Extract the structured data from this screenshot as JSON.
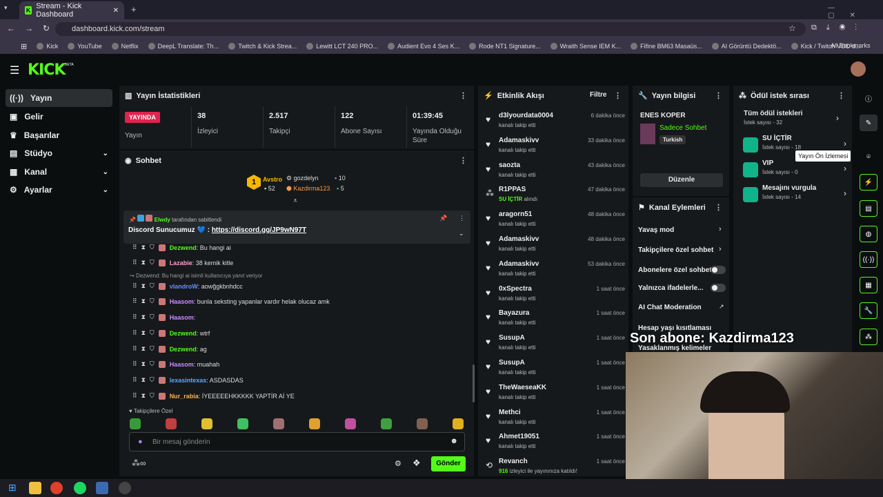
{
  "browser": {
    "tab_title": "Stream - Kick Dashboard",
    "url": "dashboard.kick.com/stream",
    "bookmarks": [
      "Kick",
      "YouTube",
      "Netflix",
      "DeepL Translate: Th...",
      "Twitch & Kick Strea...",
      "Lewitt LCT 240 PRO...",
      "Audient Evo 4 Ses K...",
      "Rode NT1 Signature...",
      "Wraith Sense IEM K...",
      "Fifine BM63 Masaüs...",
      "AI Görüntü Dedektö...",
      "Kick / Twitch VOD d..."
    ],
    "all_bookmarks": "All Bookmarks"
  },
  "logo": "KICK",
  "beta": "BETA",
  "sidebar": [
    {
      "label": "Yayın"
    },
    {
      "label": "Gelir"
    },
    {
      "label": "Başarılar"
    },
    {
      "label": "Stüdyo"
    },
    {
      "label": "Kanal"
    },
    {
      "label": "Ayarlar"
    }
  ],
  "stats": {
    "title": "Yayın İstatistikleri",
    "live_badge": "YAYINDA",
    "live_label": "Yayın",
    "items": [
      {
        "value": "38",
        "label": "İzleyici"
      },
      {
        "value": "2.517",
        "label": "Takipçi"
      },
      {
        "value": "122",
        "label": "Abone Sayısı"
      },
      {
        "value": "01:39:45",
        "label": "Yayında Olduğu Süre"
      }
    ]
  },
  "chat": {
    "title": "Sohbet",
    "leaders": [
      {
        "name": "Avstro",
        "count": "52"
      },
      {
        "name": "gozdelyn",
        "count": "10"
      },
      {
        "name": "Kazdirma123",
        "count": "5"
      }
    ],
    "pinned_by": "Elwdy",
    "pinned_suffix": "tarafından sabitlendi",
    "pinned_msg": "Discord Sunucumuz",
    "pinned_link": "https://discord.gg/JP9wN97T",
    "reply_note": "Dezwend: Bu hangi ai isimli kullanıcıya yanıt veriyor",
    "messages": [
      {
        "user": "Dezwend",
        "text": ": Bu hangi ai",
        "color": "#53fc18"
      },
      {
        "user": "Lazabie",
        "text": ": 38 kemik kitle",
        "color": "#ff9ecf"
      },
      {
        "user": "vlandroW",
        "text": ": aowğgkbnhdcc",
        "color": "#6a8cff"
      },
      {
        "user": "Haasom",
        "text": ": bunla seksting yapanlar vardır helak olucaz amk",
        "color": "#c88bff"
      },
      {
        "user": "Haasom",
        "text": ":",
        "color": "#c88bff"
      },
      {
        "user": "Dezwend",
        "text": ": wtrf",
        "color": "#53fc18"
      },
      {
        "user": "Dezwend",
        "text": ": ag",
        "color": "#53fc18"
      },
      {
        "user": "Haasom",
        "text": ": muahah",
        "color": "#c88bff"
      },
      {
        "user": "lexasintexas",
        "text": ": ASDASDAS",
        "color": "#5aa8ff"
      },
      {
        "user": "Nur_rabia",
        "text": ": İYEEEEEHKKKKK YAPTİR Aİ YE",
        "color": "#ffb347"
      }
    ],
    "emote_label": "Takipçilere Özel",
    "placeholder": "Bir mesaj gönderin",
    "send": "Gönder",
    "infinity": "∞"
  },
  "activity": {
    "title": "Etkinlik Akışı",
    "filter": "Filtre",
    "events": [
      {
        "name": "d3lyourdata0004",
        "sub": "kanalı takip etti",
        "time": "6 dakika önce"
      },
      {
        "name": "Adamaskivv",
        "sub": "kanalı takip etti",
        "time": "33 dakika önce"
      },
      {
        "name": "saozta",
        "sub": "kanalı takip etti",
        "time": "43 dakika önce"
      },
      {
        "name": "R1PPAS",
        "sub": "SU İÇTİR",
        "sub2": "alındı",
        "time": "47 dakika önce"
      },
      {
        "name": "aragorn51",
        "sub": "kanalı takip etti",
        "time": "48 dakika önce"
      },
      {
        "name": "Adamaskivv",
        "sub": "kanalı takip etti",
        "time": "48 dakika önce"
      },
      {
        "name": "Adamaskivv",
        "sub": "kanalı takip etti",
        "time": "53 dakika önce"
      },
      {
        "name": "0xSpectra",
        "sub": "kanalı takip etti",
        "time": "1 saat önce"
      },
      {
        "name": "Bayazura",
        "sub": "kanalı takip etti",
        "time": "1 saat önce"
      },
      {
        "name": "SusupA",
        "sub": "kanalı takip etti",
        "time": "1 saat önce"
      },
      {
        "name": "SusupA",
        "sub": "kanalı takip etti",
        "time": "1 saat önce"
      },
      {
        "name": "TheWaeseaKK",
        "sub": "kanalı takip etti",
        "time": "1 saat önce"
      },
      {
        "name": "Methci",
        "sub": "kanalı takip etti",
        "time": "1 saat önce"
      },
      {
        "name": "Ahmet19051",
        "sub": "kanalı takip etti",
        "time": "1 saat önce"
      },
      {
        "name": "Revanch",
        "sub": "916",
        "sub2": "izleyici ile yayınınıza katıldı!",
        "time": "1 saat önce"
      }
    ]
  },
  "info": {
    "title": "Yayın bilgisi",
    "streamer": "ENES KOPER",
    "category": "Sadece Sohbet",
    "tag": "Turkish",
    "edit": "Düzenle"
  },
  "actions": {
    "title": "Kanal Eylemleri",
    "items": [
      "Yavaş mod",
      "Takipçilere özel sohbet",
      "Abonelere özel sohbet",
      "Yalnızca ifadelerle...",
      "AI Chat Moderation",
      "Hesap yaşı kısıtlaması",
      "Yasaklanmış kelimeler"
    ]
  },
  "rewards": {
    "title": "Ödül istek sırası",
    "all": "Tüm ödül istekleri",
    "all_count": "İstek sayısı - 32",
    "items": [
      {
        "name": "SU İÇTİR",
        "count": "İstek sayısı - 18"
      },
      {
        "name": "VIP",
        "count": "İstek sayısı - 0"
      },
      {
        "name": "Mesajını vurgula",
        "count": "İstek sayısı - 14"
      }
    ]
  },
  "tooltip": "Yayın Ön İzlemesi",
  "overlay": "Son abone: Kazdirma123"
}
